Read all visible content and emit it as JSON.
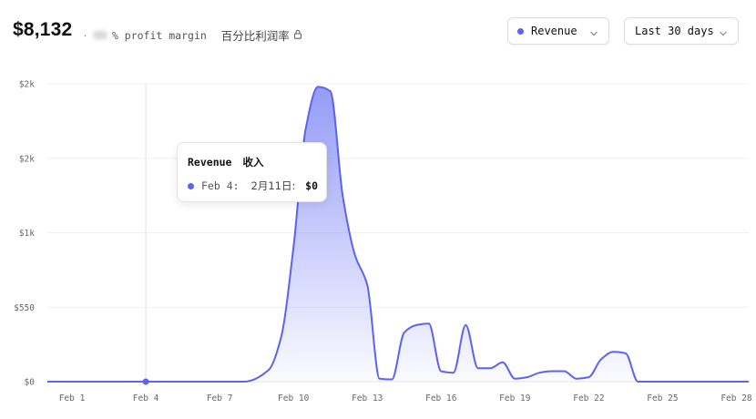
{
  "header": {
    "total": "$8,132",
    "separator": "·",
    "margin_suffix": "% profit margin",
    "margin_cjk": "百分比利润率"
  },
  "controls": {
    "metric_select": "Revenue",
    "range_select": "Last 30 days"
  },
  "tooltip": {
    "title": "Revenue",
    "title_cjk": "收入",
    "date": "Feb 4:",
    "date_cjk": "2月11日:",
    "value": "$0"
  },
  "colors": {
    "accent": "#5b63ef",
    "fill_top": "#8f97f7",
    "grid": "#f0f0f0"
  },
  "chart_data": {
    "type": "area",
    "x_labels": [
      "Feb 1",
      "Feb 4",
      "Feb 7",
      "Feb 10",
      "Feb 13",
      "Feb 16",
      "Feb 19",
      "Feb 22",
      "Feb 25",
      "Feb 28"
    ],
    "x_label_days": [
      1,
      4,
      7,
      10,
      13,
      16,
      19,
      22,
      25,
      28
    ],
    "y_tick_labels": [
      "$2k",
      "$2k",
      "$1k",
      "$550",
      "$0"
    ],
    "y_tick_values": [
      2000,
      1500,
      1000,
      500,
      0
    ],
    "ylim": [
      0,
      2000
    ],
    "grid": true,
    "series": [
      {
        "name": "Revenue",
        "days": [
          0,
          1,
          2,
          3,
          4,
          5,
          6,
          7,
          8,
          9,
          9.5,
          10,
          10.5,
          11,
          11.5,
          12,
          12.5,
          13,
          13.5,
          14,
          14.5,
          15,
          15.5,
          16,
          16.5,
          17,
          17.5,
          18,
          18.5,
          19,
          19.5,
          20,
          20.5,
          21,
          21.5,
          22,
          22.5,
          23,
          23.5,
          24,
          24.5,
          25,
          25.5,
          26,
          26.5,
          27,
          27.5,
          28,
          28.5
        ],
        "values": [
          0,
          0,
          0,
          0,
          0,
          0,
          0,
          0,
          0,
          80,
          300,
          900,
          1700,
          1980,
          1950,
          1250,
          850,
          650,
          20,
          15,
          330,
          380,
          390,
          70,
          60,
          380,
          90,
          90,
          130,
          20,
          30,
          60,
          70,
          70,
          20,
          30,
          150,
          200,
          190,
          0,
          0,
          0,
          0,
          0,
          0,
          0,
          0,
          0,
          0
        ]
      }
    ],
    "highlight": {
      "day": 4,
      "value": 0
    }
  }
}
